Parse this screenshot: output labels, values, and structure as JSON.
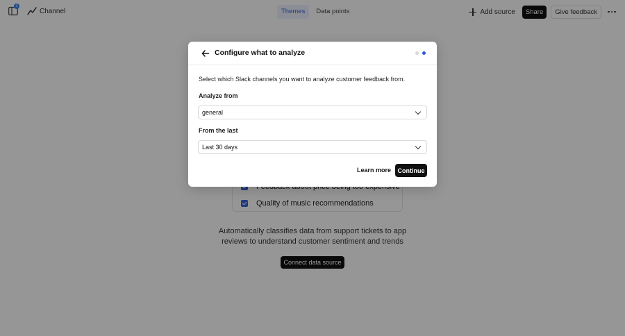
{
  "topbar": {
    "notification_count": "1",
    "channel_label": "Channel",
    "tabs": [
      {
        "label": "Themes"
      },
      {
        "label": "Data points"
      }
    ],
    "add_source_label": "Add source",
    "share_label": "Share",
    "give_feedback_label": "Give feedback"
  },
  "background": {
    "items": [
      {
        "label": "Feedback about price being too expensive"
      },
      {
        "label": "Quality of music recommendations"
      }
    ],
    "description": "Automatically classifies data from support tickets to app reviews to understand customer sentiment and trends",
    "connect_label": "Connect data source"
  },
  "modal": {
    "title": "Configure what to analyze",
    "steps": {
      "total": 2,
      "current": 2
    },
    "instruction": "Select which Slack channels you want to analyze customer feedback from.",
    "analyze_from_label": "Analyze from",
    "analyze_from_value": "general",
    "from_last_label": "From the last",
    "from_last_value": "Last 30 days",
    "learn_more_label": "Learn more",
    "continue_label": "Continue"
  },
  "colors": {
    "accent": "#2f5bd3",
    "overlay": "rgba(0,0,0,0.41)",
    "button_dark": "#111111"
  },
  "icons": {
    "sidebar_toggle": "sidebar-toggle-icon",
    "channel": "line-chart-icon",
    "add": "plus-icon",
    "more": "more-horizontal-icon",
    "back": "arrow-left-icon",
    "select": "chevron-down-icon",
    "check": "checkbox-checked-icon"
  }
}
